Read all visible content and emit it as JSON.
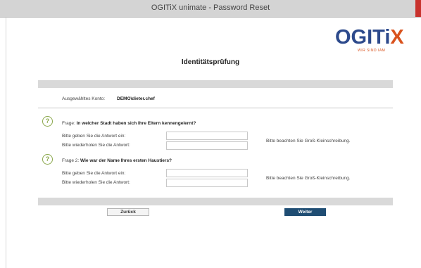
{
  "window": {
    "title": "OGITiX unimate - Password Reset"
  },
  "logo": {
    "text_main": "OGITi",
    "text_x": "X",
    "tagline": "WIR SIND IAM"
  },
  "page": {
    "heading": "Identitätsprüfung"
  },
  "account": {
    "label": "Ausgewähltes Konto:",
    "value": "DEMO\\dieter.chef"
  },
  "questions": [
    {
      "prefix": "Frage:",
      "text": "In welcher Stadt haben sich Ihre Eltern kennengelernt?",
      "answer_label": "Bitte geben Sie die Antwort ein:",
      "repeat_label": "Bitte wiederholen Sie die Antwort:",
      "hint": "Bitte beachten Sie Groß-Kleinschreibung.",
      "answer_value": "",
      "repeat_value": ""
    },
    {
      "prefix": "Frage 2:",
      "text": "Wie war der Name Ihres ersten Haustiers?",
      "answer_label": "Bitte geben Sie die Antwort ein:",
      "repeat_label": "Bitte wiederholen Sie die Antwort:",
      "hint": "Bitte beachten Sie Groß-Kleinschreibung.",
      "answer_value": "",
      "repeat_value": ""
    }
  ],
  "buttons": {
    "back": "Zurück",
    "next": "Weiter"
  },
  "colors": {
    "brand_blue": "#2d4a8c",
    "brand_orange": "#d9531e",
    "primary_button": "#1f4d73",
    "question_icon": "#8ba84c"
  },
  "icons": {
    "question": "question-circle-icon",
    "close": "close-icon"
  }
}
